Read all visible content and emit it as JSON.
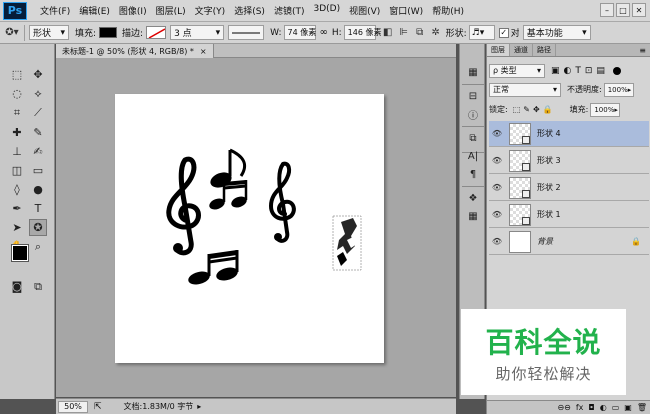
{
  "app": {
    "logo": "Ps"
  },
  "menu": [
    "文件(F)",
    "编辑(E)",
    "图像(I)",
    "图层(L)",
    "文字(Y)",
    "选择(S)",
    "滤镜(T)",
    "3D(D)",
    "视图(V)",
    "窗口(W)",
    "帮助(H)"
  ],
  "window_controls": {
    "minimize": "–",
    "restore": "□",
    "close": "✕"
  },
  "options": {
    "mode": "形状",
    "fill_label": "填充:",
    "stroke_label": "描边:",
    "stroke_width": "3 点",
    "w_label": "W:",
    "w_value": "74 像素",
    "h_label": "H:",
    "h_value": "146 像素",
    "shape_label": "形状:",
    "align_label": "对齐边缘",
    "workspace": "基本功能"
  },
  "document": {
    "tab_title": "未标题-1 @ 50% (形状 4, RGB/8) *",
    "close": "×",
    "zoom": "50%",
    "doc_info": "文档:1.83M/0 字节"
  },
  "layers_panel": {
    "tabs": [
      "图层",
      "通道",
      "路径"
    ],
    "filter": "类型",
    "blend_mode": "正常",
    "opacity_label": "不透明度:",
    "opacity": "100%",
    "lock_label": "锁定:",
    "fill_label": "填充:",
    "fill": "100%",
    "layers": [
      {
        "name": "形状 4",
        "selected": true
      },
      {
        "name": "形状 3",
        "selected": false
      },
      {
        "name": "形状 2",
        "selected": false
      },
      {
        "name": "形状 1",
        "selected": false
      },
      {
        "name": "背景",
        "selected": false,
        "locked": true
      }
    ],
    "bottom_icons": [
      "link-icon",
      "fx-icon",
      "mask-icon",
      "adjustment-icon",
      "folder-icon",
      "new-layer-icon",
      "trash-icon"
    ]
  },
  "watermark": {
    "title": "百科全说",
    "subtitle": "助你轻松解决"
  },
  "colors": {
    "accent_green": "#22b24c",
    "selected_layer": "#aabcdc"
  }
}
